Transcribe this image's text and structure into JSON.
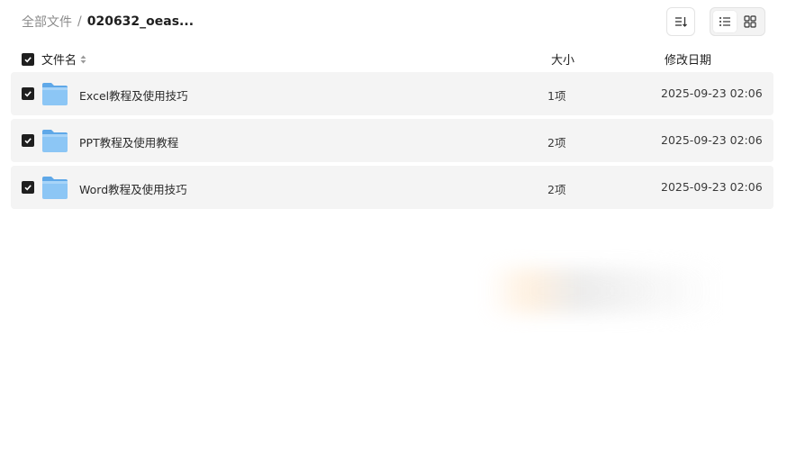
{
  "breadcrumb": {
    "root": "全部文件",
    "separator": "/",
    "current": "020632_oeas..."
  },
  "toolbar": {
    "sort_icon": "sort-desc-icon",
    "list_view_icon": "list-view-icon",
    "grid_view_icon": "grid-view-icon",
    "active_view": "list"
  },
  "table": {
    "columns": {
      "name": "文件名",
      "size": "大小",
      "date": "修改日期"
    },
    "rows": [
      {
        "name": "Excel教程及使用技巧",
        "size": "1项",
        "date": "2025-09-23 02:06",
        "checked": true,
        "icon": "folder-icon"
      },
      {
        "name": "PPT教程及使用教程",
        "size": "2项",
        "date": "2025-09-23 02:06",
        "checked": true,
        "icon": "folder-icon"
      },
      {
        "name": "Word教程及使用技巧",
        "size": "2项",
        "date": "2025-09-23 02:06",
        "checked": true,
        "icon": "folder-icon"
      }
    ]
  },
  "colors": {
    "folder": "#7fbff0",
    "row_bg": "#f4f4f4",
    "checkbox": "#1f1f1f"
  }
}
